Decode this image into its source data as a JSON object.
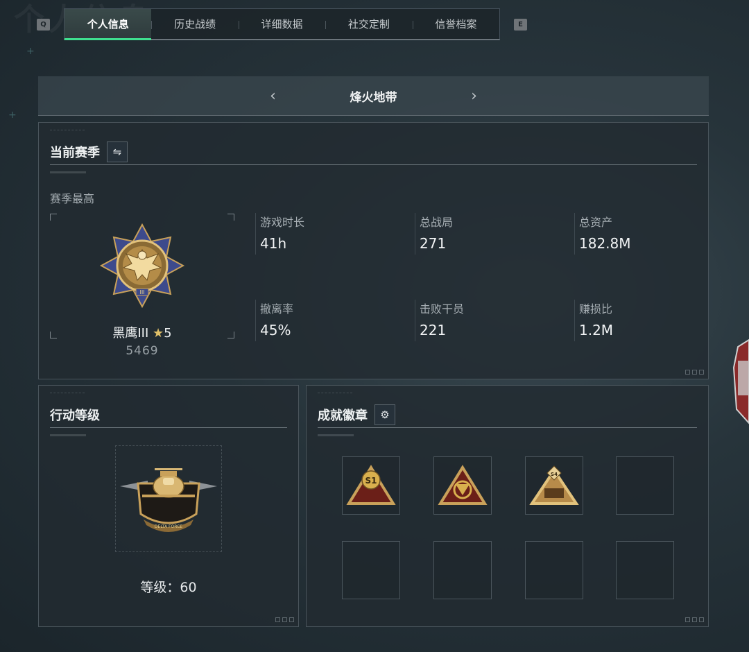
{
  "tabs": {
    "prev_key": "Q",
    "next_key": "E",
    "items": [
      "个人信息",
      "历史战绩",
      "详细数据",
      "社交定制",
      "信誉档案"
    ]
  },
  "mode": {
    "title": "烽火地带",
    "prev_icon": "chevron-left-icon",
    "next_icon": "chevron-right-icon"
  },
  "season": {
    "title": "当前赛季",
    "switch_icon": "swap-icon",
    "best_label": "赛季最高",
    "rank_name": "黑鹰III",
    "rank_stars": "5",
    "rank_score": "5469",
    "stats": [
      {
        "label": "游戏时长",
        "value": "41h"
      },
      {
        "label": "总战局",
        "value": "271"
      },
      {
        "label": "总资产",
        "value": "182.8M"
      },
      {
        "label": "撤离率",
        "value": "45%"
      },
      {
        "label": "击败干员",
        "value": "221"
      },
      {
        "label": "赚损比",
        "value": "1.2M"
      }
    ]
  },
  "level": {
    "title": "行动等级",
    "text": "等级：60",
    "emblem_text": "DELTA FORCE"
  },
  "badges": {
    "title": "成就徽章",
    "settings_icon": "gear-icon",
    "slots": [
      {
        "filled": true,
        "label": "S1"
      },
      {
        "filled": true,
        "label": ""
      },
      {
        "filled": true,
        "label": "S4"
      },
      {
        "filled": false,
        "label": ""
      },
      {
        "filled": false,
        "label": ""
      },
      {
        "filled": false,
        "label": ""
      },
      {
        "filled": false,
        "label": ""
      },
      {
        "filled": false,
        "label": ""
      }
    ]
  },
  "colors": {
    "accent_tab": "#3fe08f",
    "gold": "#c9a15a"
  }
}
